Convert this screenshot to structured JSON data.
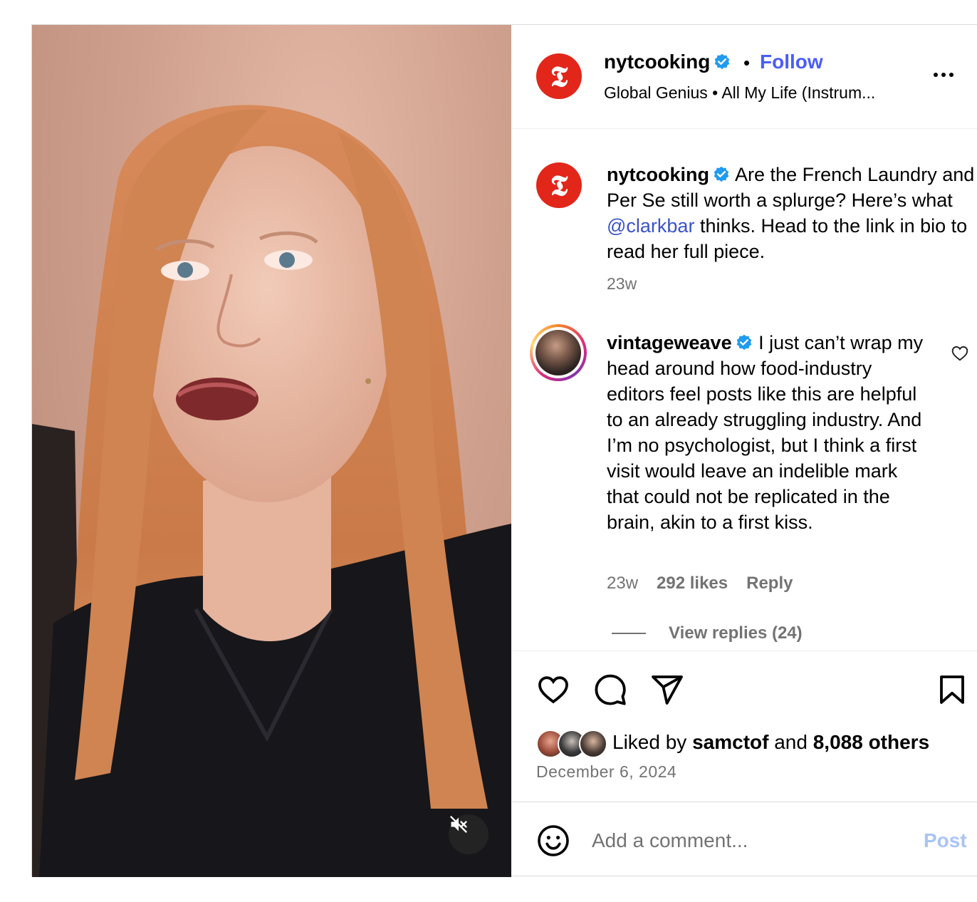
{
  "header": {
    "username": "nytcooking",
    "separator": "•",
    "follow_label": "Follow",
    "audio": "Global Genius • All My Life (Instrum..."
  },
  "caption": {
    "username": "nytcooking",
    "text_before": "Are the French Laundry and Per Se still worth a splurge? Here’s what ",
    "mention": "@clarkbar",
    "text_after": " thinks. Head to the link in bio to read her full piece.",
    "time": "23w"
  },
  "comment": {
    "username": "vintageweave",
    "text": "I just can’t wrap my head around how food-industry editors feel posts like this are helpful to an already struggling industry. And I’m no psychologist, but I think a first visit would leave an indelible mark that could not be replicated in the brain, akin to a first kiss.",
    "time": "23w",
    "likes": "292 likes",
    "reply_label": "Reply",
    "view_replies": "View replies (24)"
  },
  "engagement": {
    "liked_by_prefix": "Liked by ",
    "liked_by_user": "samctof",
    "liked_by_mid": " and ",
    "others": "8,088 others",
    "date": "December 6, 2024"
  },
  "composer": {
    "placeholder": "Add a comment...",
    "post_label": "Post"
  },
  "icons": [
    "verified-badge-icon",
    "more-options-icon",
    "heart-icon",
    "comment-icon",
    "share-icon",
    "bookmark-icon",
    "emoji-icon",
    "mute-icon"
  ],
  "colors": {
    "follow": "#4a5df9",
    "mention": "#3a53c8",
    "nyt_red": "#e2261a",
    "verified": "#1f9bf0",
    "post_disabled": "#a9c4f5",
    "meta_gray": "#737373"
  }
}
